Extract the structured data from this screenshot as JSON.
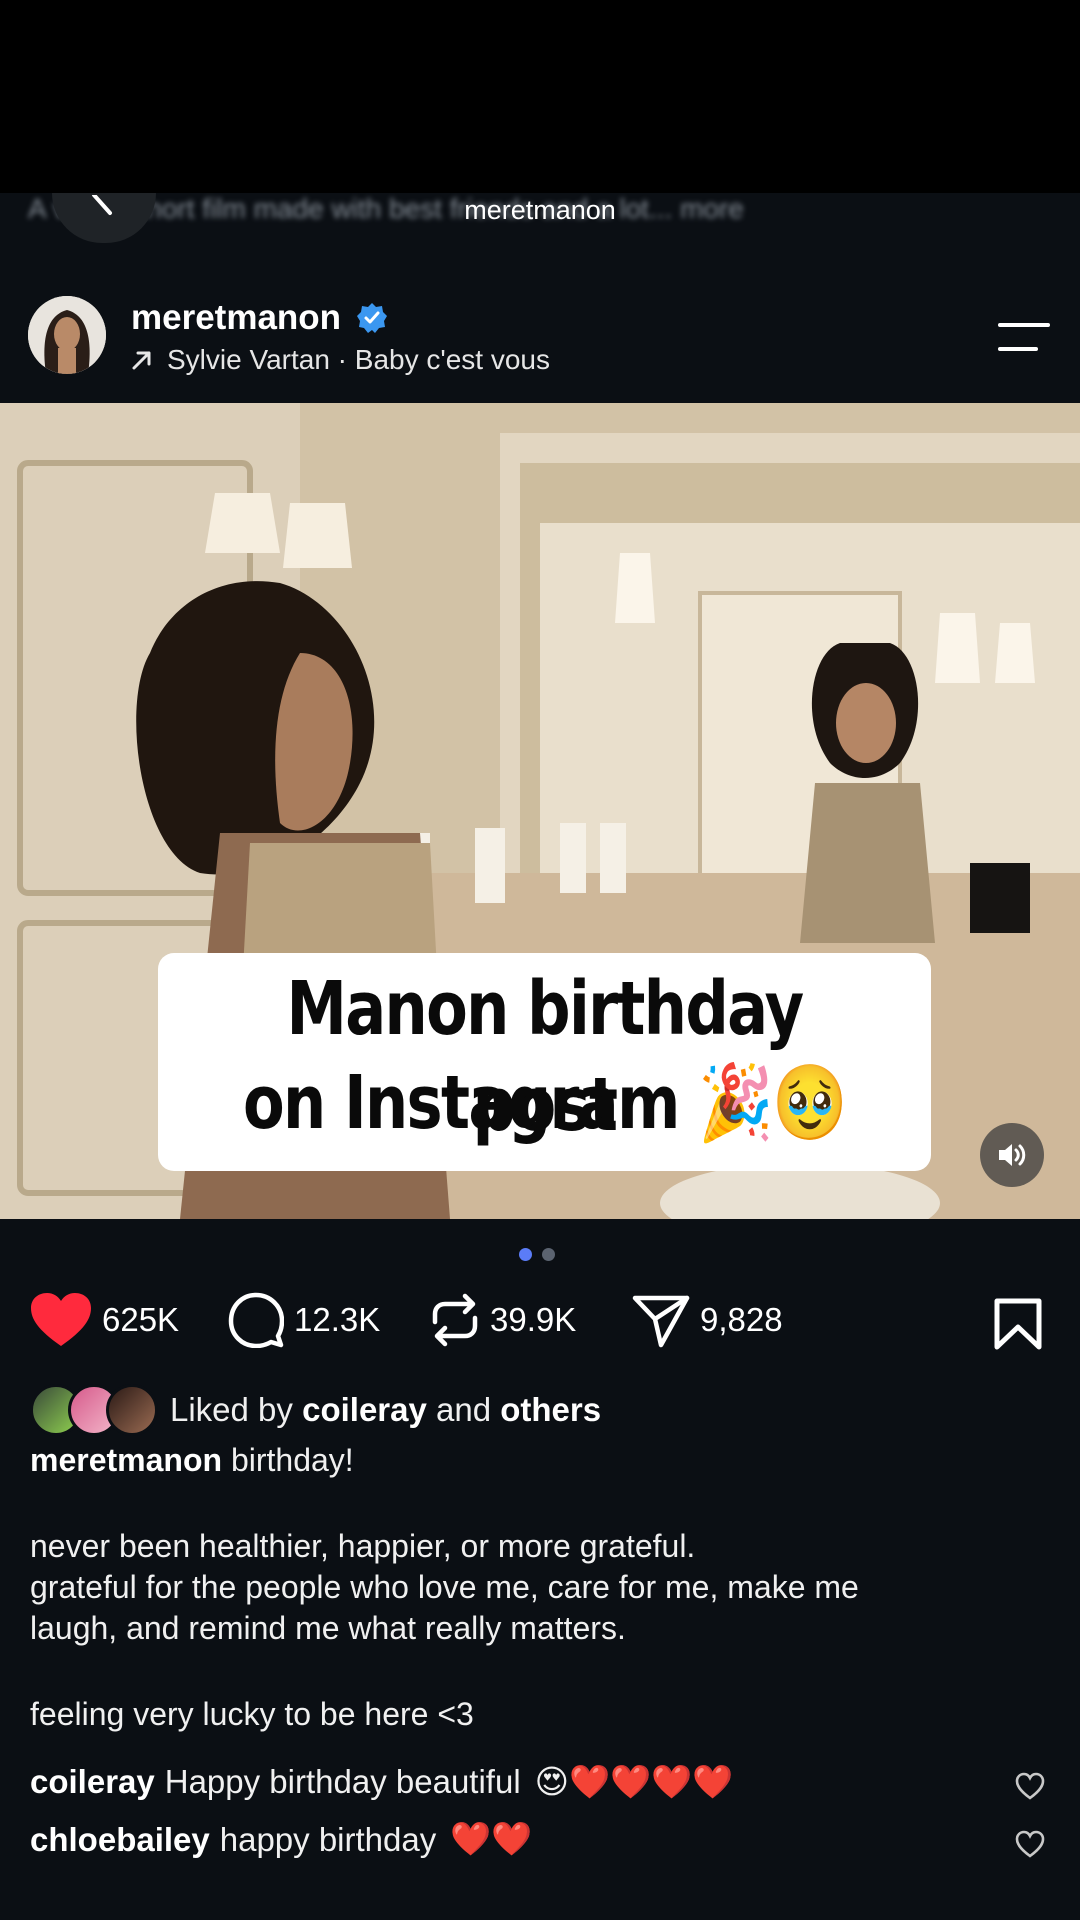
{
  "ticker": {
    "blurred_text": "A visual short film made with best friends and a lot... more",
    "title": "meretmanon"
  },
  "post": {
    "username": "meretmanon",
    "verified": true,
    "music_icon": "arrow-up-right-icon",
    "music": "Sylvie Vartan · Baby c'est vous",
    "overlay_line1": "Manon birthday post",
    "overlay_line2": "on Instagram",
    "overlay_emojis": "🎉🥹"
  },
  "carousel": {
    "count": 2,
    "active": 1
  },
  "actions": {
    "likes": "625K",
    "comments": "12.3K",
    "reposts": "39.9K",
    "shares": "9,828"
  },
  "liked_by": {
    "prefix": "Liked by",
    "user": "coileray",
    "conj": "and",
    "rest": "others"
  },
  "caption": {
    "username": "meretmanon",
    "first_line": "birthday!",
    "line2": "never been healthier, happier, or more grateful.",
    "line3": "grateful for the people who love me, care for me, make me",
    "line4": "laugh, and remind me what really matters.",
    "line5": "feeling very lucky to be here <3"
  },
  "comments": [
    {
      "user": "coileray",
      "text": "Happy birthday beautiful",
      "emojis": "😍❤️❤️❤️❤️"
    },
    {
      "user": "chloebailey",
      "text": "happy birthday",
      "emojis": "❤️❤️"
    }
  ],
  "colors": {
    "background": "#0b0f14",
    "like_red": "#ff2a3d",
    "verified_blue": "#3b97f0",
    "dot_active": "#5b7cf7"
  }
}
